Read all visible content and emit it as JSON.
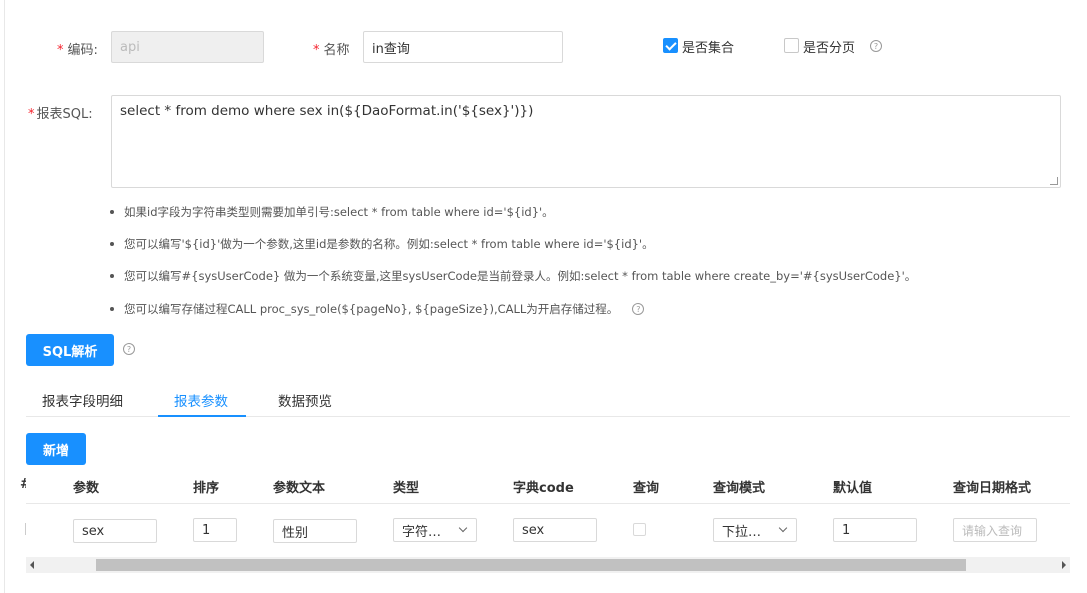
{
  "form": {
    "required_mark": "*",
    "code_label": "编码:",
    "code_value": "api",
    "name_label": "名称",
    "name_value": "in查询",
    "is_collection_label": "是否集合",
    "is_collection_checked": true,
    "is_paged_label": "是否分页",
    "is_paged_checked": false,
    "sql_label": "报表SQL:",
    "sql_value": "select * from demo where sex in(${DaoFormat.in('${sex}')})",
    "help_icon": "?"
  },
  "tips": [
    "如果id字段为字符串类型则需要加单引号:select * from table where id='${id}'。",
    "您可以编写'${id}'做为一个参数,这里id是参数的名称。例如:select * from table where id='${id}'。",
    "您可以编写#{sysUserCode} 做为一个系统变量,这里sysUserCode是当前登录人。例如:select * from table where create_by='#{sysUserCode}'。",
    "您可以编写存储过程CALL proc_sys_role(${pageNo}, ${pageSize}),CALL为开启存储过程。"
  ],
  "sql_parse_button": "SQL解析",
  "tabs": [
    {
      "label": "报表字段明细",
      "active": false
    },
    {
      "label": "报表参数",
      "active": true
    },
    {
      "label": "数据预览",
      "active": false
    }
  ],
  "add_button": "新增",
  "table": {
    "headers": [
      "#",
      "参数",
      "排序",
      "参数文本",
      "类型",
      "字典code",
      "查询",
      "查询模式",
      "默认值",
      "查询日期格式"
    ],
    "row": {
      "param": "sex",
      "order": "1",
      "text": "性别",
      "type": "字符…",
      "dict_code": "sex",
      "query_checked": false,
      "query_mode": "下拉…",
      "default_value": "1",
      "date_format_placeholder": "请输入查询"
    }
  },
  "colors": {
    "primary": "#1890ff",
    "required": "#f5222d"
  }
}
